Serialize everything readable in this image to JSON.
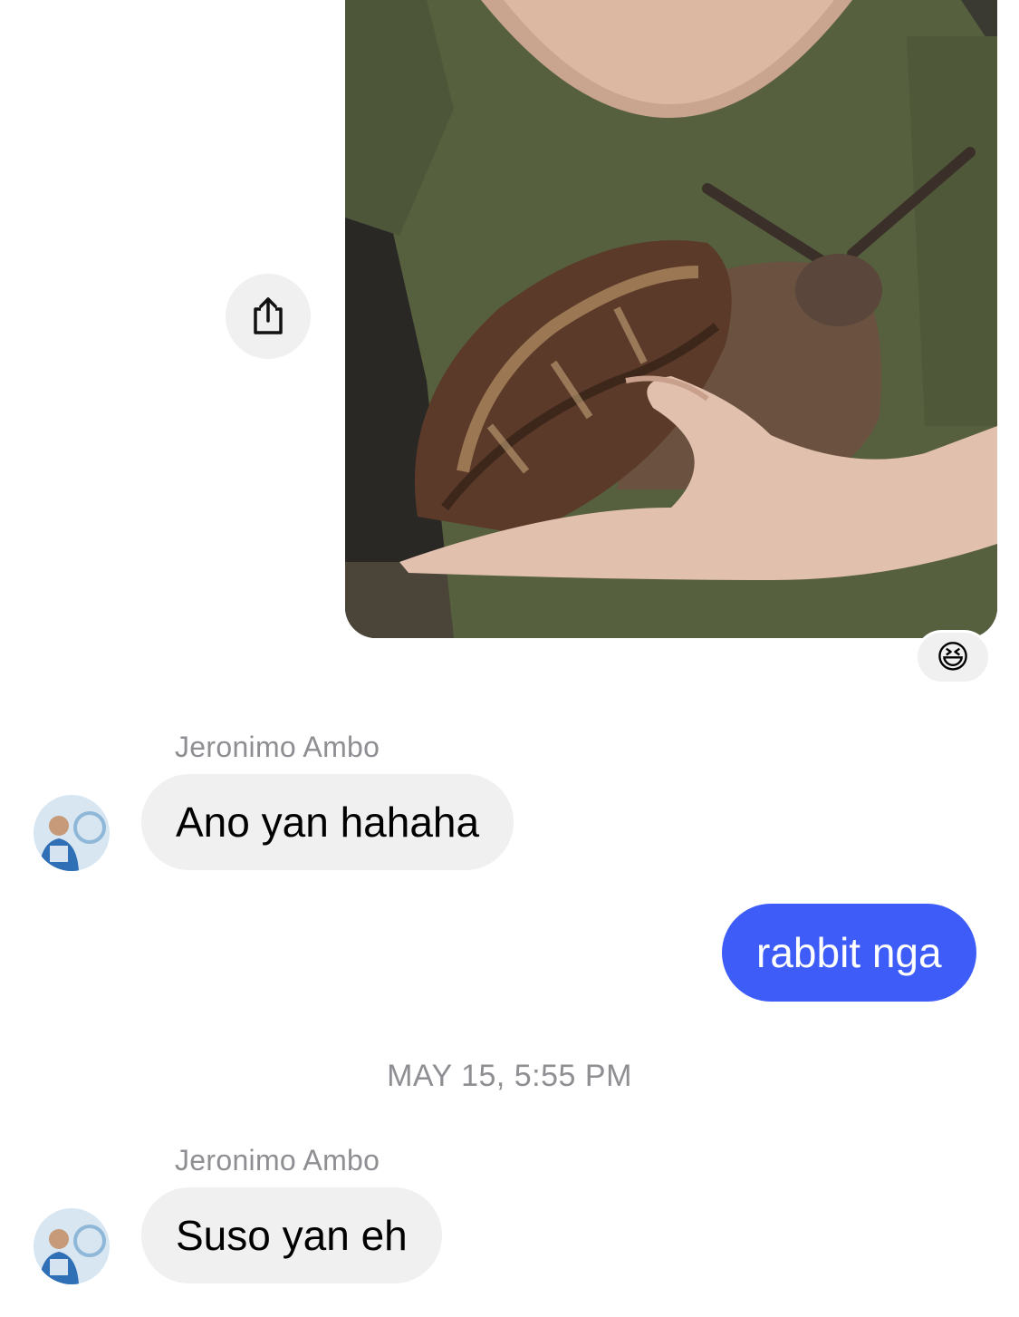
{
  "colors": {
    "outgoing_bubble": "#3e5cf7",
    "incoming_bubble": "#f0f0f0",
    "meta_text": "#8e8e93"
  },
  "conversation": {
    "shared_photo": {
      "description_icon": "photo",
      "share_icon": "share-icon",
      "reaction": "😆"
    },
    "messages": [
      {
        "sender": "Jeronimo Ambo",
        "direction": "incoming",
        "text": "Ano yan hahaha"
      },
      {
        "direction": "outgoing",
        "text": "rabbit nga"
      },
      {
        "sender": "Jeronimo Ambo",
        "direction": "incoming",
        "text": "Suso yan eh"
      }
    ],
    "timestamp": "MAY 15, 5:55 PM"
  }
}
